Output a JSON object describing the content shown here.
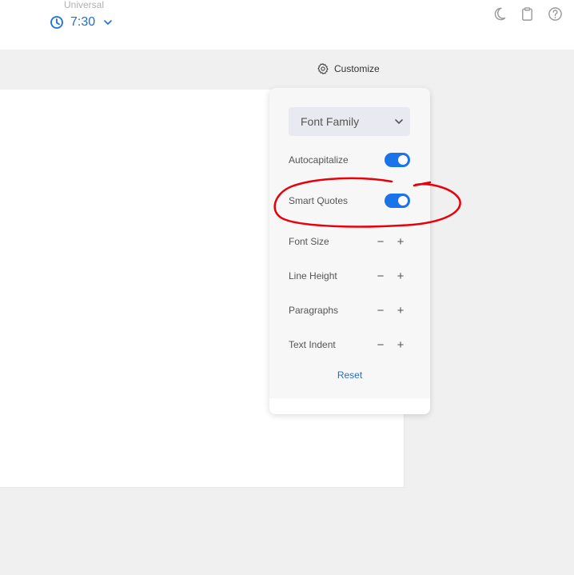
{
  "header": {
    "timezone_label": "Universal",
    "time_value": "7:30",
    "icons": [
      "moon-icon",
      "clipboard-icon",
      "help-icon"
    ]
  },
  "customize": {
    "button_label": "Customize"
  },
  "panel": {
    "font_family": {
      "selected": "Font Family"
    },
    "toggles": [
      {
        "label": "Autocapitalize",
        "on": true
      },
      {
        "label": "Smart Quotes",
        "on": true
      }
    ],
    "steppers": [
      {
        "label": "Font Size",
        "minus": "−",
        "plus": "+"
      },
      {
        "label": "Line Height",
        "minus": "−",
        "plus": "+"
      },
      {
        "label": "Paragraphs",
        "minus": "−",
        "plus": "+"
      },
      {
        "label": "Text Indent",
        "minus": "−",
        "plus": "+"
      }
    ],
    "reset_label": "Reset"
  },
  "colors": {
    "accent": "#1a73e8",
    "annotation": "#e8000b",
    "panel_bg": "#f7f7f7",
    "page_bg": "#f0f0f0"
  }
}
